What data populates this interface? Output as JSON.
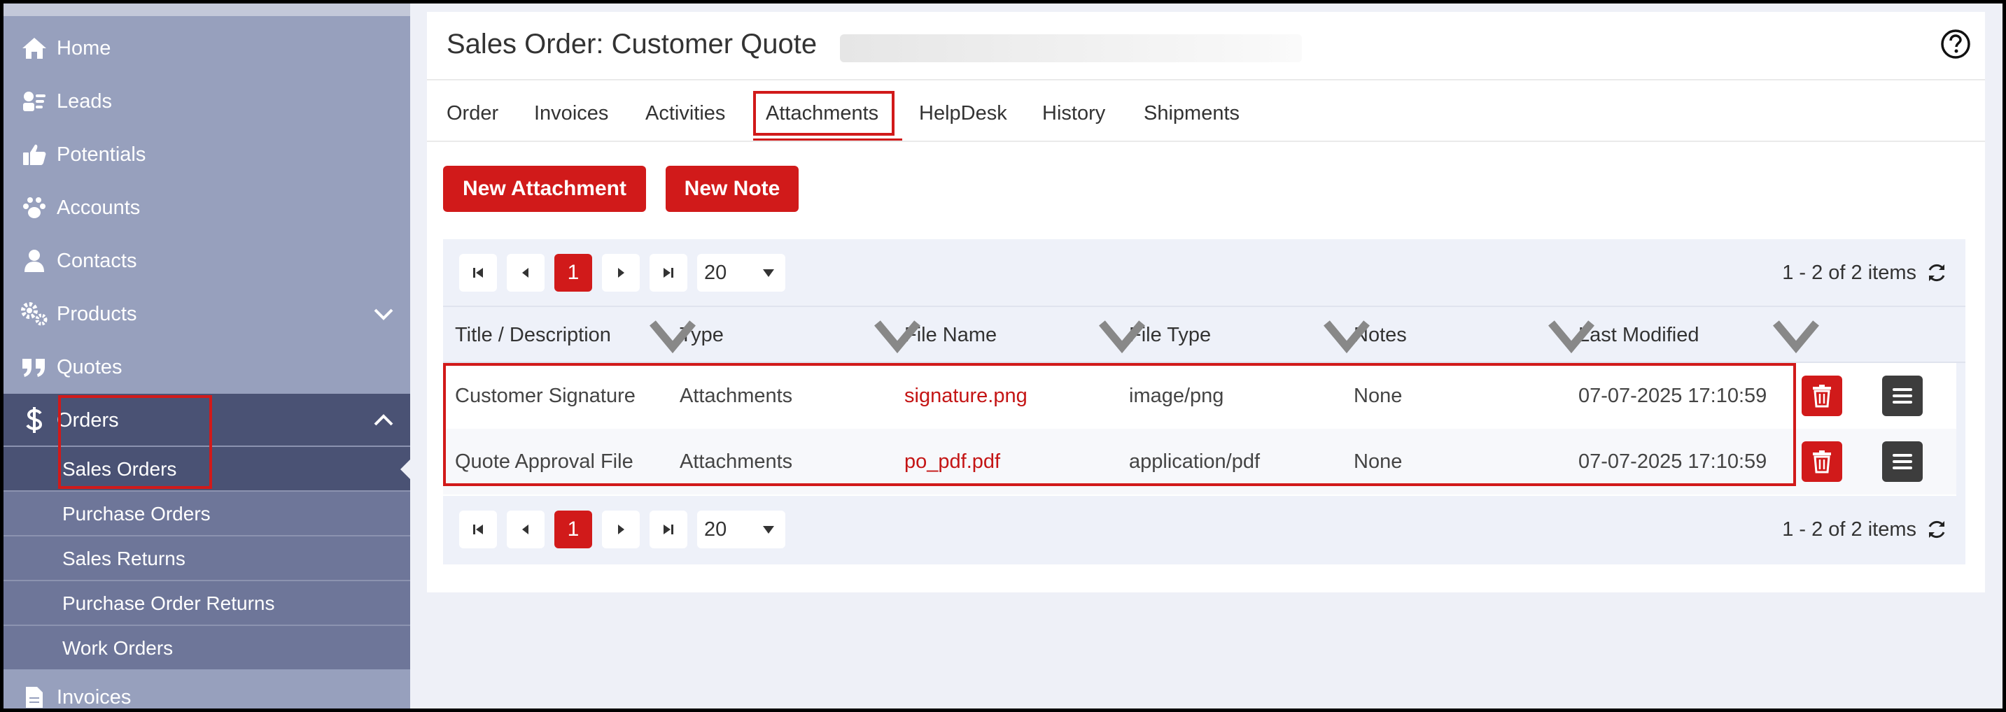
{
  "sidebar": {
    "items": [
      {
        "label": "Home",
        "icon": "home-icon"
      },
      {
        "label": "Leads",
        "icon": "leads-icon"
      },
      {
        "label": "Potentials",
        "icon": "thumbs-up-icon"
      },
      {
        "label": "Accounts",
        "icon": "paw-icon"
      },
      {
        "label": "Contacts",
        "icon": "user-icon"
      },
      {
        "label": "Products",
        "icon": "gears-icon"
      },
      {
        "label": "Quotes",
        "icon": "quote-icon"
      },
      {
        "label": "Orders",
        "icon": "dollar-icon"
      },
      {
        "label": "Invoices",
        "icon": "document-icon"
      }
    ],
    "sub_items": [
      "Sales Orders",
      "Purchase Orders",
      "Sales Returns",
      "Purchase Order Returns",
      "Work Orders"
    ]
  },
  "header": {
    "title": "Sales Order: Customer Quote"
  },
  "tabs": [
    "Order",
    "Invoices",
    "Activities",
    "Attachments",
    "HelpDesk",
    "History",
    "Shipments"
  ],
  "actions": {
    "new_attachment": "New Attachment",
    "new_note": "New Note"
  },
  "pager": {
    "current_page": "1",
    "page_size": "20",
    "info": "1 - 2 of 2 items"
  },
  "table": {
    "columns": [
      "Title / Description",
      "Type",
      "File Name",
      "File Type",
      "Notes",
      "Last Modified"
    ],
    "rows": [
      {
        "title": "Customer Signature",
        "type": "Attachments",
        "file_name": "signature.png",
        "file_type": "image/png",
        "notes": "None",
        "modified": "07-07-2025 17:10:59"
      },
      {
        "title": "Quote Approval File",
        "type": "Attachments",
        "file_name": "po_pdf.pdf",
        "file_type": "application/pdf",
        "notes": "None",
        "modified": "07-07-2025 17:10:59"
      }
    ]
  },
  "colors": {
    "accent": "#d11a1a",
    "sidebar": "#97a0bd",
    "sidebar_active": "#4a5274",
    "sidebar_sub": "#6e7699"
  }
}
